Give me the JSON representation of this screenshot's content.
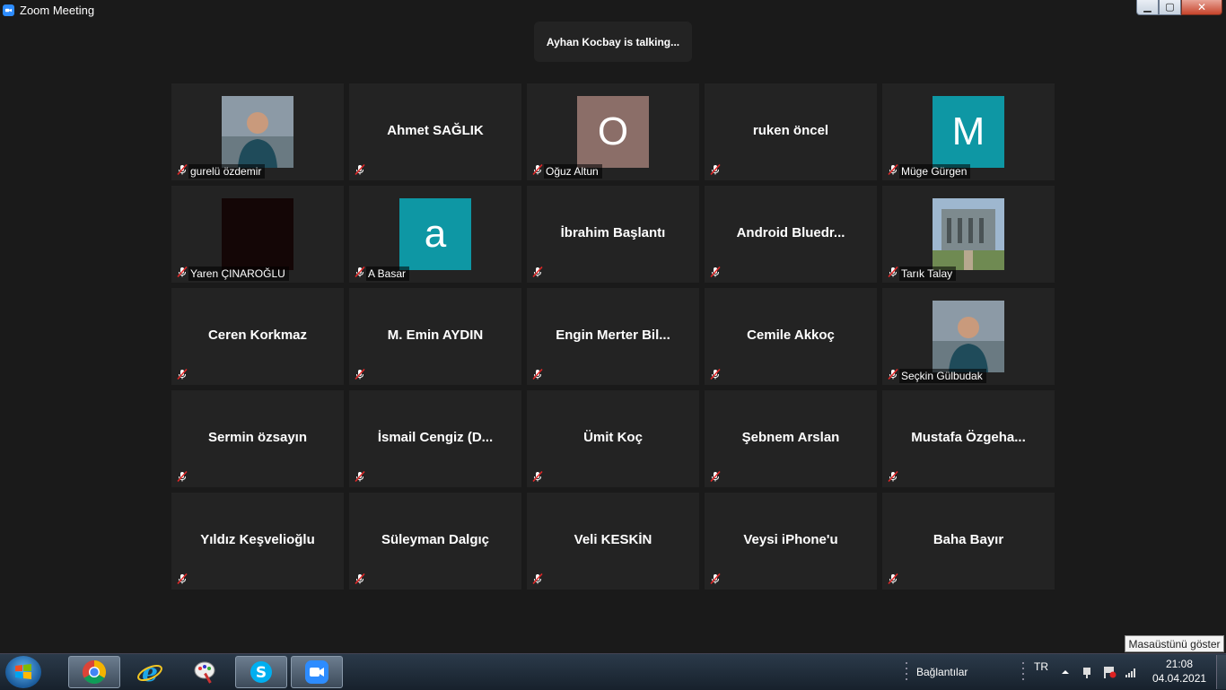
{
  "window": {
    "title": "Zoom Meeting",
    "controls": {
      "minimize": "▁",
      "maximize": "▢",
      "close": "✕"
    }
  },
  "banner": {
    "talking_text": "Ayhan Kocbay is talking..."
  },
  "participants": [
    {
      "type": "photo",
      "name_label": "gurelü özdemir",
      "muted": true,
      "icon": "person-photo"
    },
    {
      "type": "name",
      "display": "Ahmet SAĞLIK",
      "muted": true
    },
    {
      "type": "avatar",
      "letter": "O",
      "color": "#8b6e68",
      "name_label": "Oğuz Altun",
      "muted": true
    },
    {
      "type": "name",
      "display": "ruken öncel",
      "muted": true
    },
    {
      "type": "avatar",
      "letter": "M",
      "color": "#0e97a4",
      "name_label": "Müge Gürgen",
      "muted": true
    },
    {
      "type": "photo",
      "name_label": "Yaren ÇINAROĞLU",
      "muted": true,
      "icon": "dark-photo"
    },
    {
      "type": "avatar",
      "letter": "a",
      "color": "#0e97a4",
      "name_label": "A Basar",
      "muted": true
    },
    {
      "type": "name",
      "display": "İbrahim Başlantı",
      "muted": true
    },
    {
      "type": "name",
      "display": "Android  Bluedr...",
      "muted": true
    },
    {
      "type": "photo",
      "name_label": "Tarık Talay",
      "muted": true,
      "icon": "building-photo"
    },
    {
      "type": "name",
      "display": "Ceren Korkmaz",
      "muted": true
    },
    {
      "type": "name",
      "display": "M. Emin AYDIN",
      "muted": true
    },
    {
      "type": "name",
      "display": "Engin  Merter  Bil...",
      "muted": true
    },
    {
      "type": "name",
      "display": "Cemile Akkoç",
      "muted": true
    },
    {
      "type": "photo",
      "name_label": "Seçkin Gülbudak",
      "muted": true,
      "icon": "person-photo"
    },
    {
      "type": "name",
      "display": "Sermin özsayın",
      "muted": true
    },
    {
      "type": "name",
      "display": "İsmail  Cengiz  (D...",
      "muted": true
    },
    {
      "type": "name",
      "display": "Ümit Koç",
      "muted": true
    },
    {
      "type": "name",
      "display": "Şebnem Arslan",
      "muted": true
    },
    {
      "type": "name",
      "display": "Mustafa  Özgeha...",
      "muted": true
    },
    {
      "type": "name",
      "display": "Yıldız Keşvelioğlu",
      "muted": true
    },
    {
      "type": "name",
      "display": "Süleyman Dalgıç",
      "muted": true
    },
    {
      "type": "name",
      "display": "Veli KESKİN",
      "muted": true
    },
    {
      "type": "name",
      "display": "Veysi iPhone'u",
      "muted": true
    },
    {
      "type": "name",
      "display": "Baha Bayır",
      "muted": true
    }
  ],
  "taskbar": {
    "apps": [
      {
        "name": "chrome-icon"
      },
      {
        "name": "internet-explorer-icon"
      },
      {
        "name": "paint-icon"
      },
      {
        "name": "skype-icon"
      },
      {
        "name": "zoom-icon"
      }
    ],
    "toolbar_label": "Bağlantılar",
    "language": "TR",
    "show_desktop_tooltip": "Masaüstünü göster",
    "time": "21:08",
    "date": "04.04.2021"
  }
}
